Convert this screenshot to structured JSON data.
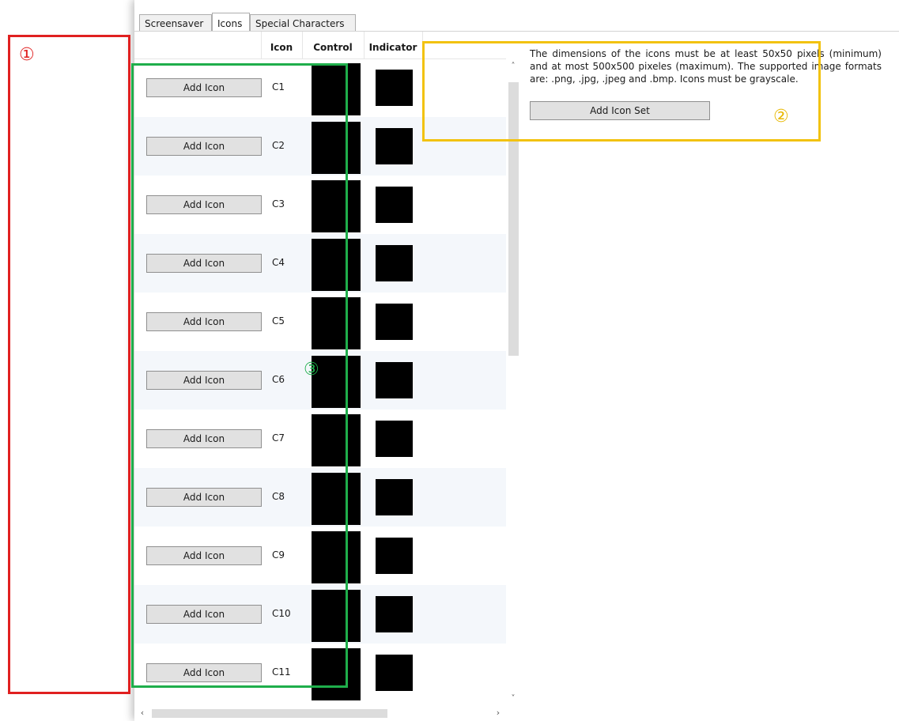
{
  "tabs": [
    {
      "label": "Screensaver",
      "active": false
    },
    {
      "label": "Icons",
      "active": true
    },
    {
      "label": "Special Characters",
      "active": false
    }
  ],
  "grid": {
    "headers": {
      "icon": "Icon",
      "control": "Control",
      "indicator": "Indicator"
    },
    "add_icon_label": "Add Icon",
    "rows": [
      "C1",
      "C2",
      "C3",
      "C4",
      "C5",
      "C6",
      "C7",
      "C8",
      "C9",
      "C10",
      "C11"
    ]
  },
  "scroll": {
    "up": "˄",
    "down": "˅",
    "left": "‹",
    "right": "›"
  },
  "info_text": "The dimensions of the icons must be at least 50x50 pixels (minimum) and at most 500x500 pixeles (maximum). The supported image formats are: .png, .jpg, .jpeg and .bmp. Icons must be grayscale.",
  "add_icon_set_label": "Add Icon Set",
  "callouts": {
    "one": "①",
    "two": "②",
    "three": "③"
  },
  "colors": {
    "callout_red": "#e02020",
    "callout_yellow": "#f2c20f",
    "callout_green": "#1fae4b"
  }
}
